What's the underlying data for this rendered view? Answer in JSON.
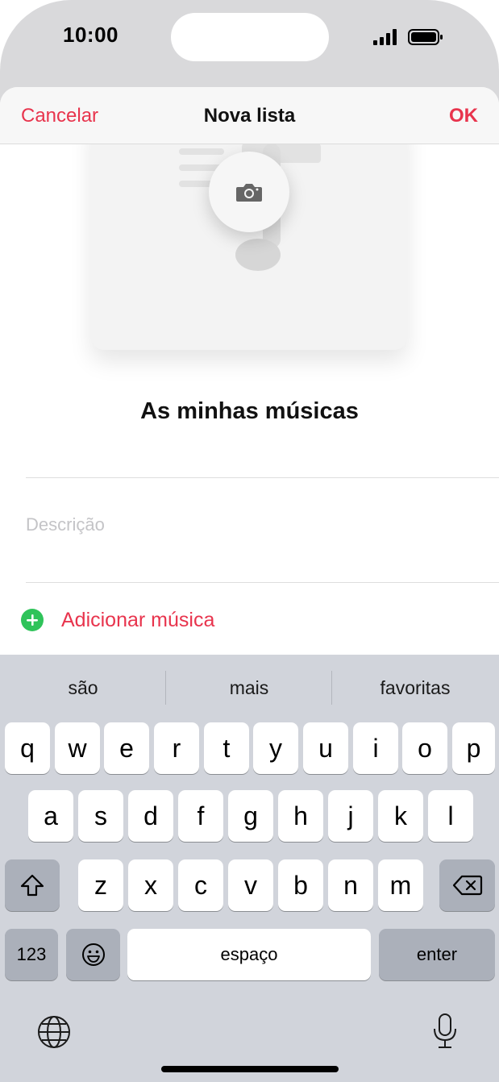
{
  "status": {
    "time": "10:00"
  },
  "nav": {
    "cancel": "Cancelar",
    "title": "Nova lista",
    "ok": "OK"
  },
  "playlist": {
    "name": "As minhas músicas",
    "description_placeholder": "Descrição",
    "add_music": "Adicionar música"
  },
  "keyboard": {
    "suggestions": [
      "são",
      "mais",
      "favoritas"
    ],
    "row1": [
      "q",
      "w",
      "e",
      "r",
      "t",
      "y",
      "u",
      "i",
      "o",
      "p"
    ],
    "row2": [
      "a",
      "s",
      "d",
      "f",
      "g",
      "h",
      "j",
      "k",
      "l"
    ],
    "row3": [
      "z",
      "x",
      "c",
      "v",
      "b",
      "n",
      "m"
    ],
    "numbers": "123",
    "space": "espaço",
    "enter": "enter"
  },
  "colors": {
    "accent": "#e8344d",
    "add_icon": "#2fc35a",
    "keyboard_bg": "#d1d4db"
  }
}
